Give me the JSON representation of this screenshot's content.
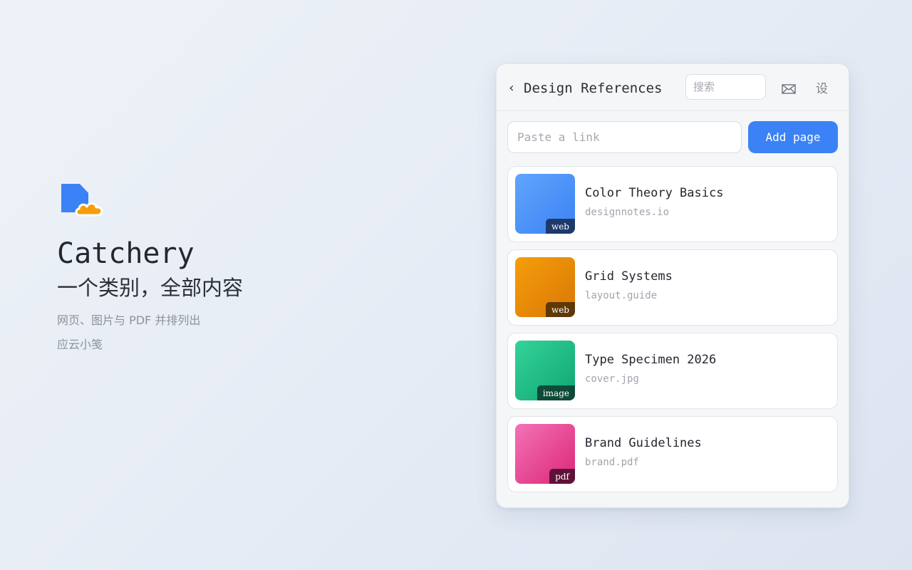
{
  "hero": {
    "app_name": "Catchery",
    "tagline": "一个类别，全部内容",
    "subline_1": "网页、图片与 PDF 并排列出",
    "subline_2": "应云小笺",
    "logo_icon": "document-cloud-icon",
    "colors": {
      "doc": "#3b82f6",
      "cloud": "#f59e0b"
    }
  },
  "panel": {
    "header": {
      "back_icon": "chevron-left-icon",
      "back_glyph": "‹",
      "title": "Design References",
      "search_placeholder": "搜索",
      "mail_icon": "mail-icon",
      "settings_label": "设"
    },
    "link_input": {
      "placeholder": "Paste a link",
      "value": ""
    },
    "add_button": {
      "label": "Add page",
      "color": "#3b82f6"
    },
    "items": [
      {
        "title": "Color Theory Basics",
        "subtitle": "designnotes.io",
        "badge": "web",
        "gradient": [
          "#60a5fa",
          "#3b82f6"
        ],
        "badge_bg": "#1e3a6b"
      },
      {
        "title": "Grid Systems",
        "subtitle": "layout.guide",
        "badge": "web",
        "gradient": [
          "#f59e0b",
          "#d97706"
        ],
        "badge_bg": "#5e3806"
      },
      {
        "title": "Type Specimen 2026",
        "subtitle": "cover.jpg",
        "badge": "image",
        "gradient": [
          "#34d399",
          "#10a572"
        ],
        "badge_bg": "#0d4b38"
      },
      {
        "title": "Brand Guidelines",
        "subtitle": "brand.pdf",
        "badge": "pdf",
        "gradient": [
          "#f472b6",
          "#db2777"
        ],
        "badge_bg": "#5e1238"
      }
    ]
  }
}
